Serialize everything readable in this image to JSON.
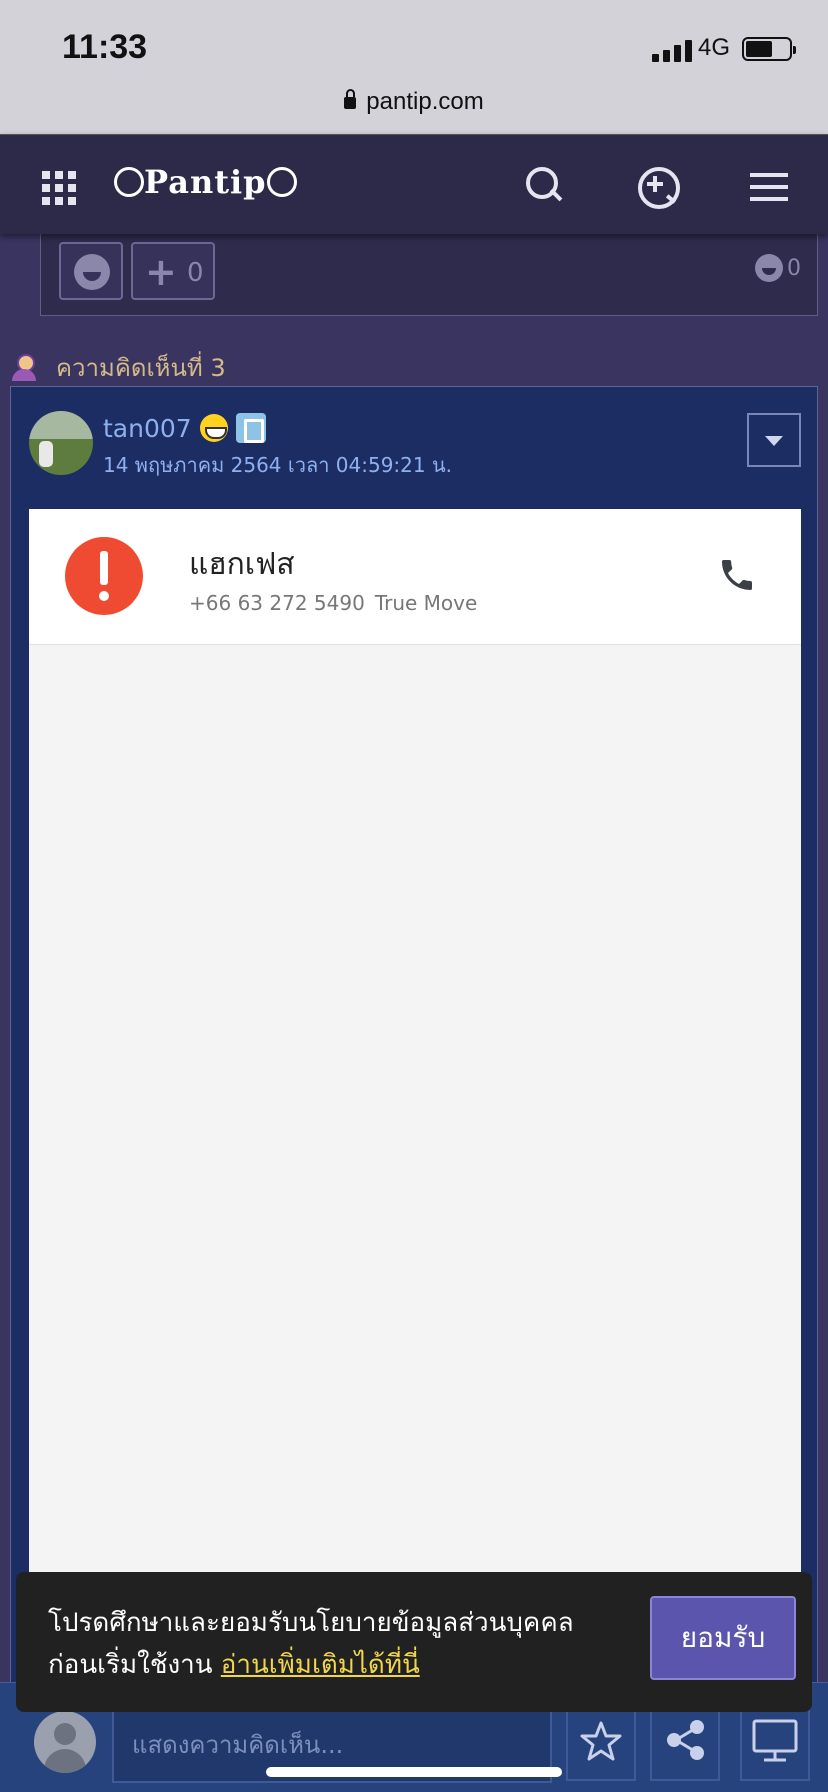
{
  "status_bar": {
    "time": "11:33",
    "network": "4G",
    "url": "pantip.com"
  },
  "header": {
    "logo": "Pantip"
  },
  "prev_comment": {
    "plus_count": "0",
    "emotion_count": "0"
  },
  "comment": {
    "label": "ความคิดเห็นที่ 3",
    "username": "tan007",
    "datetime": "14 พฤษภาคม 2564 เวลา 04:59:21 น."
  },
  "call_screenshot": {
    "caller_name": "แฮกเฟส",
    "phone_number": "+66 63 272 5490",
    "carrier": "True Move"
  },
  "cookie_banner": {
    "text_line1": "โปรดศึกษาและยอมรับนโยบายข้อมูลส่วนบุคคล",
    "text_line2": "ก่อนเริ่มใช้งาน",
    "link": "อ่านเพิ่มเติมได้ที่นี่",
    "accept": "ยอมรับ"
  },
  "bottom_bar": {
    "comment_placeholder": "แสดงความคิดเห็น..."
  },
  "colors": {
    "header_bg": "#2d2948",
    "card_bg": "#1c2d63",
    "alert_red": "#ef4b32",
    "accept_purple": "#5b55ad",
    "link_yellow": "#f0d64a"
  }
}
